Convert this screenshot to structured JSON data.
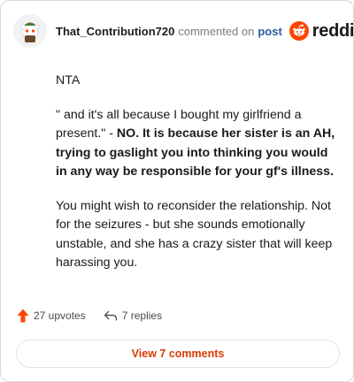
{
  "comment": {
    "username": "That_Contribution720",
    "action_text": "commented on",
    "post_link": "post",
    "logo_text": "reddit",
    "paragraphs": {
      "p1": "NTA",
      "p2_normal": "\" and it's all because I bought my girlfriend a present.\" - ",
      "p2_bold": "NO. It is because her sister is an AH, trying to gaslight you into thinking you would in any way be responsible for your gf's illness.",
      "p3": "You might wish to reconsider the relationship. Not for the seizures - but she sounds emotionally unstable, and she has a crazy sister that will keep harassing you."
    },
    "upvotes": "27 upvotes",
    "replies": "7 replies",
    "view_comments": "View 7 comments"
  },
  "colors": {
    "reddit_orange": "#ff4500",
    "view_button_text": "#d93a00",
    "post_link": "#2b5aa6"
  },
  "icons": {
    "avatar": "snoo-avatar",
    "logo": "reddit-logo-icon",
    "upvote": "upvote-arrow-icon",
    "reply": "reply-arrow-icon"
  }
}
